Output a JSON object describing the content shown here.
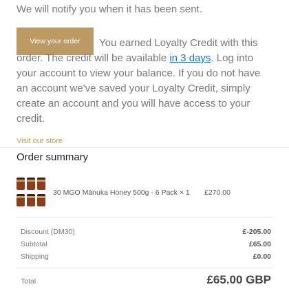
{
  "notify_text": "We will notify you when it has been sent.",
  "view_order_button": "View your order",
  "credit_message": {
    "before_link": "You earned Loyalty Credit with this order. The credit will be available ",
    "link": "in 3 days",
    "after_link": ". Log into your account to view your balance. If you do not have an account we've saved your Loyalty Credit, simply create an account and you will have access to your credit."
  },
  "store_link": "Visit our store",
  "order_summary": {
    "title": "Order summary",
    "items": [
      {
        "name": "30 MGO Mānuka Honey 500g - 6 Pack × 1",
        "price": "£270.00"
      }
    ],
    "rows": [
      {
        "label": "Discount (DM30)",
        "value": "£-205.00"
      },
      {
        "label": "Subtotal",
        "value": "£65.00"
      },
      {
        "label": "Shipping",
        "value": "£0.00"
      }
    ],
    "total": {
      "label": "Total",
      "value": "£65.00 GBP"
    }
  },
  "colors": {
    "accent": "#bb9a64",
    "link": "#1a73c7",
    "text": "#777777"
  }
}
